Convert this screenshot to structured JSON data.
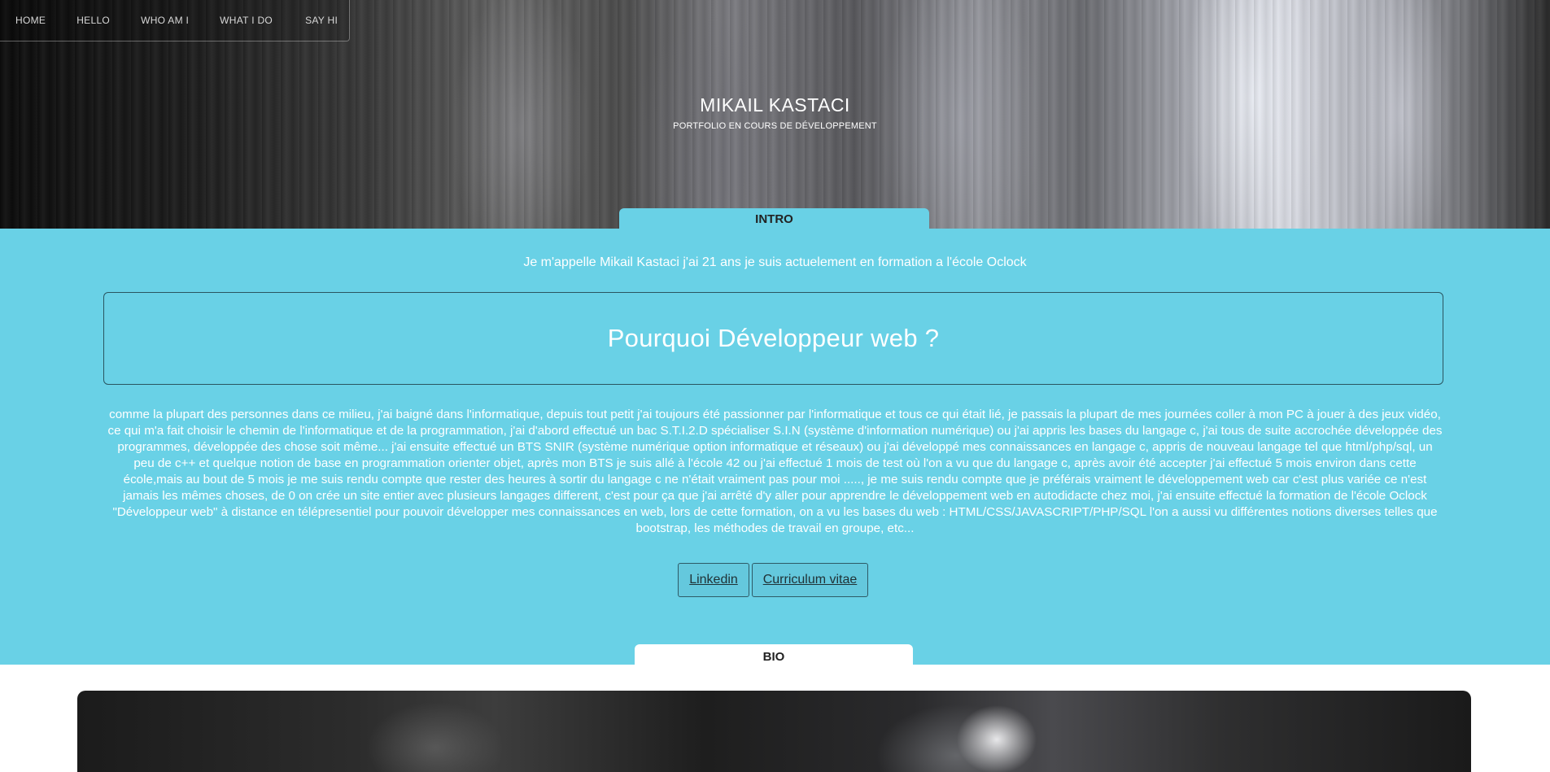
{
  "nav": {
    "items": [
      {
        "label": "HOME"
      },
      {
        "label": "HELLO"
      },
      {
        "label": "WHO AM I"
      },
      {
        "label": "WHAT I DO"
      },
      {
        "label": "SAY HI"
      }
    ]
  },
  "hero": {
    "title": "MIKAIL KASTACI",
    "subtitle": "PORTFOLIO EN COURS DE DÉVELOPPEMENT"
  },
  "intro": {
    "tab_label": "INTRO",
    "line": "Je m'appelle Mikail Kastaci j'ai 21 ans je suis actuelement en formation a l'école Oclock",
    "why_title": "Pourquoi Développeur web ?",
    "story": "comme la plupart des personnes dans ce milieu, j'ai baigné dans l'informatique, depuis tout petit j'ai toujours été passionner par l'informatique et tous ce qui était lié, je passais la plupart de mes journées coller à mon PC à jouer à des jeux vidéo, ce qui m'a fait choisir le chemin de l'informatique et de la programmation, j'ai d'abord effectué un bac S.T.I.2.D spécialiser S.I.N (système d'information numérique) ou j'ai appris les bases du langage c, j'ai tous de suite accrochée développée des programmes, développée des chose soit même... j'ai ensuite effectué un BTS SNIR (système numérique option informatique et réseaux) ou j'ai développé mes connaissances en langage c, appris de nouveau langage tel que html/php/sql, un peu de c++ et quelque notion de base en programmation orienter objet, après mon BTS je suis allé à l'école 42 ou j'ai effectué 1 mois de test où l'on a vu que du langage c, après avoir été accepter j'ai effectué 5 mois environ dans cette école,mais au bout de 5 mois je me suis rendu compte que rester des heures à sortir du langage c ne n'était vraiment pas pour moi ....., je me suis rendu compte que je préférais vraiment le développement web car c'est plus variée ce n'est jamais les mêmes choses, de 0 on crée un site entier avec plusieurs langages different, c'est pour ça que j'ai arrêté d'y aller pour apprendre le développement web en autodidacte chez moi, j'ai ensuite effectué la formation de l'école Oclock \"Développeur web\" à distance en télépresentiel pour pouvoir développer mes connaissances en web, lors de cette formation, on a vu les bases du web : HTML/CSS/JAVASCRIPT/PHP/SQL l'on a aussi vu différentes notions diverses telles que bootstrap, les méthodes de travail en groupe, etc...",
    "buttons": {
      "linkedin": "Linkedin",
      "cv": "Curriculum vitae"
    }
  },
  "bio": {
    "tab_label": "BIO"
  },
  "colors": {
    "accent": "#69d1e6",
    "text_light": "#ffffff",
    "border": "#2a5560"
  }
}
